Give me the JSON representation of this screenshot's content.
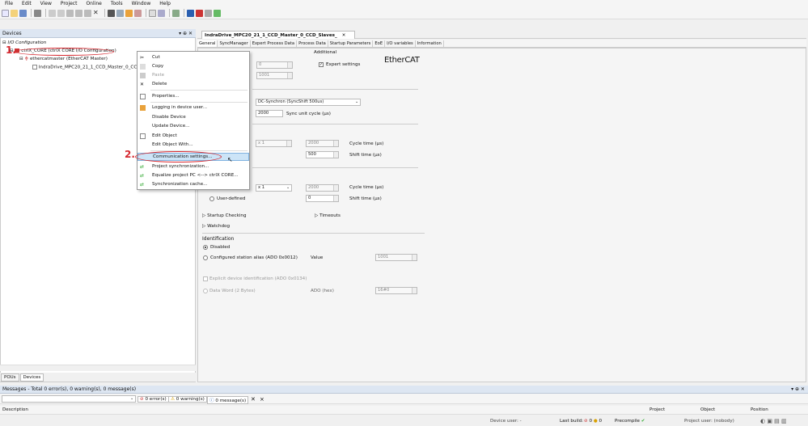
{
  "menu": [
    "File",
    "Edit",
    "View",
    "Project",
    "Online",
    "Tools",
    "Window",
    "Help"
  ],
  "devices": {
    "title": "Devices",
    "root": "I/O Configuration",
    "core": "ctrlX_CORE (ctrlX CORE I/O Configuration)",
    "master": "ethercatmaster (EtherCAT Master)",
    "slave": "IndraDrive_MPC20_21_1_CCD_Master_0_CCD...",
    "tabs": [
      "POUs",
      "Devices"
    ]
  },
  "editor": {
    "tab": "IndraDrive_MPC20_21_1_CCD_Master_0_CCD_Slaves_",
    "subtabs": [
      "General",
      "SyncManager",
      "Expert Process Data",
      "Process Data",
      "Startup Parameters",
      "EoE",
      "I/O variables",
      "Information"
    ],
    "additional": "Additional",
    "expert": "Expert settings",
    "logo": "EtherCAT",
    "f1": "0",
    "f2": "1001",
    "dc": "DC-Synchron (SyncShift 500us)",
    "sync": "2000",
    "sync_label": "Sync unit cycle (µs)",
    "x1": "x 1",
    "c1": "2000",
    "cycle": "Cycle time (µs)",
    "s1": "500",
    "shift": "Shift time (µs)",
    "x2": "x 1",
    "c2": "2000",
    "userdef": "User-defined",
    "s2": "0",
    "startup": "Startup Checking",
    "timeouts": "Timeouts",
    "watchdog": "Watchdog",
    "ident": "Identification",
    "disabled": "Disabled",
    "alias": "Configured station alias (ADO 0x0012)",
    "value": "Value",
    "aliasval": "1001",
    "explicit": "Explicit device identification (ADO 0x0134)",
    "dataword": "Data Word (2 Bytes)",
    "adohex": "ADO (hex)",
    "hexval": "16#0"
  },
  "context": [
    "Cut",
    "Copy",
    "Paste",
    "Delete",
    "Properties...",
    "Logging in device user...",
    "Disable Device",
    "Update Device...",
    "Edit Object",
    "Edit Object With...",
    "Communication settings...",
    "Project synchronization...",
    "Equalize project PC <--> ctrlX CORE...",
    "Synchronization cache..."
  ],
  "messages": {
    "title": "Messages - Total 0 error(s), 0 warning(s), 0 message(s)",
    "errors": "0 error(s)",
    "warnings": "0 warning(s)",
    "msgs": "0 message(s)",
    "cols": [
      "Description",
      "Project",
      "Object",
      "Position"
    ]
  },
  "status": {
    "device_user": "Device user: -",
    "last_build": "Last build:",
    "e": "0",
    "w": "0",
    "precompile": "Precompile",
    "project_user": "Project user: (nobody)"
  },
  "annotations": {
    "n1": "1.",
    "n2": "2."
  },
  "colors": {
    "accent": "#3399ff",
    "annotation": "#d6282f",
    "highlight": "#cce4f7"
  }
}
